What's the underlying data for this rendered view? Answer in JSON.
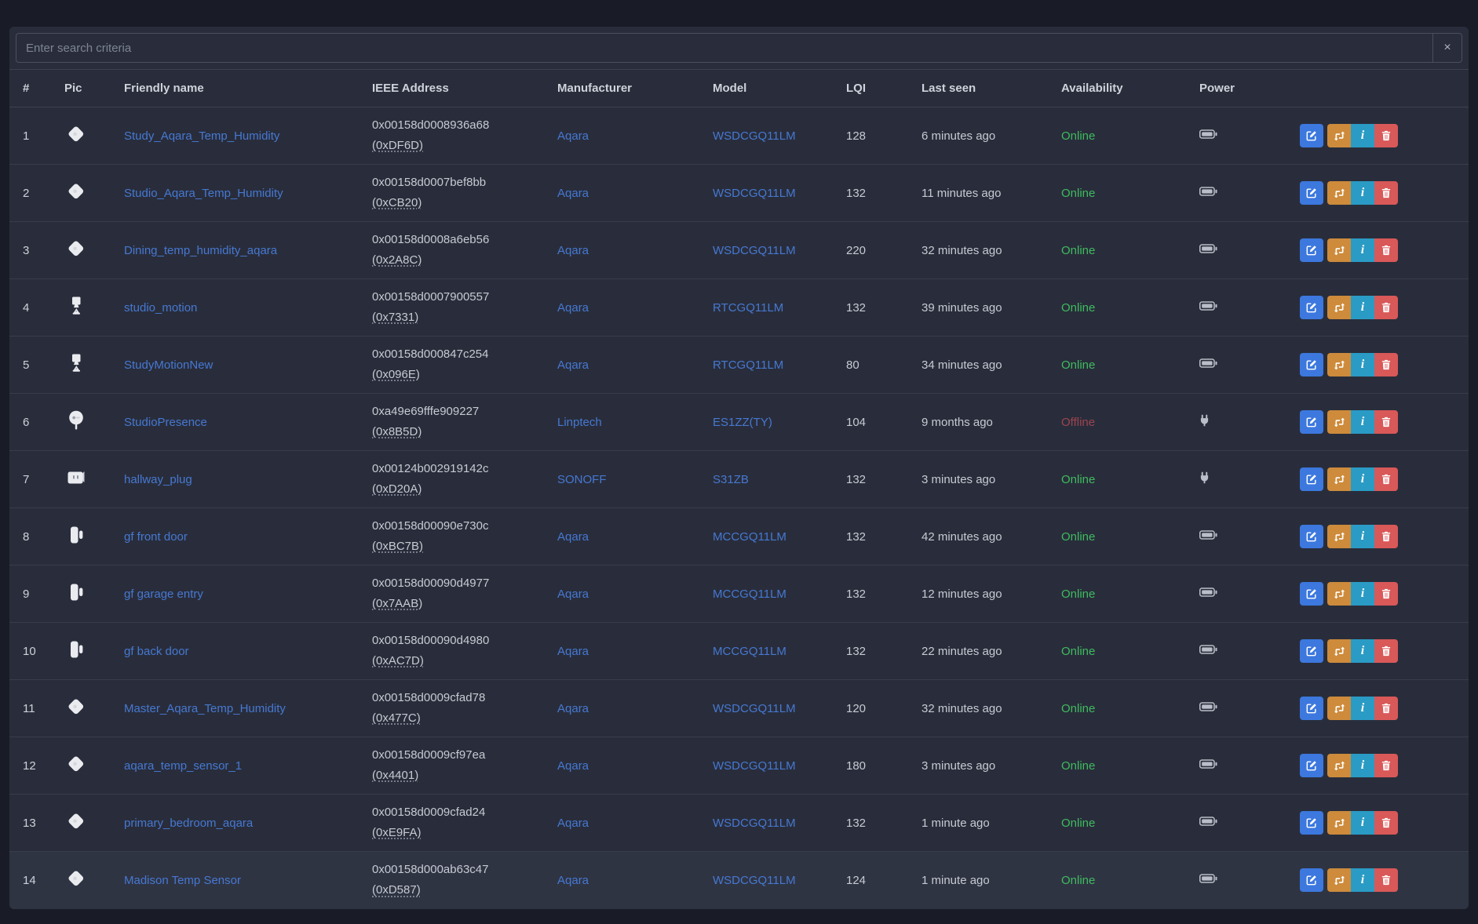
{
  "search": {
    "placeholder": "Enter search criteria",
    "clear_label": "×"
  },
  "colors": {
    "link": "#4678d2",
    "online": "#3fbb5f",
    "offline": "#9c4450",
    "primary": "#3c78de",
    "warning": "#cd8b3b",
    "info": "#2a9bc4",
    "danger": "#d95858",
    "icon_gray": "#b9bec8",
    "device_white": "#e9ebef"
  },
  "row_actions": [
    {
      "name": "rename",
      "icon": "pen-square-icon",
      "style": "primary"
    },
    {
      "name": "reconfigure",
      "icon": "reload-icon",
      "style": "warning"
    },
    {
      "name": "info",
      "icon": "info-icon",
      "style": "info"
    },
    {
      "name": "remove",
      "icon": "trash-icon",
      "style": "danger"
    }
  ],
  "table": {
    "columns": [
      "#",
      "Pic",
      "Friendly name",
      "IEEE Address",
      "Manufacturer",
      "Model",
      "LQI",
      "Last seen",
      "Availability",
      "Power",
      ""
    ],
    "rows": [
      {
        "num": "1",
        "pic": "temp-humidity-sensor",
        "friendly_name": "Study_Aqara_Temp_Humidity",
        "ieee_address": "0x00158d0008936a68",
        "network_address": "(0xDF6D)",
        "manufacturer": "Aqara",
        "model": "WSDCGQ11LM",
        "lqi": "128",
        "last_seen": "6 minutes ago",
        "availability": "Online",
        "power": "battery"
      },
      {
        "num": "2",
        "pic": "temp-humidity-sensor",
        "friendly_name": "Studio_Aqara_Temp_Humidity",
        "ieee_address": "0x00158d0007bef8bb",
        "network_address": "(0xCB20)",
        "manufacturer": "Aqara",
        "model": "WSDCGQ11LM",
        "lqi": "132",
        "last_seen": "11 minutes ago",
        "availability": "Online",
        "power": "battery"
      },
      {
        "num": "3",
        "pic": "temp-humidity-sensor",
        "friendly_name": "Dining_temp_humidity_aqara",
        "ieee_address": "0x00158d0008a6eb56",
        "network_address": "(0x2A8C)",
        "manufacturer": "Aqara",
        "model": "WSDCGQ11LM",
        "lqi": "220",
        "last_seen": "32 minutes ago",
        "availability": "Online",
        "power": "battery"
      },
      {
        "num": "4",
        "pic": "motion-sensor",
        "friendly_name": "studio_motion",
        "ieee_address": "0x00158d0007900557",
        "network_address": "(0x7331)",
        "manufacturer": "Aqara",
        "model": "RTCGQ11LM",
        "lqi": "132",
        "last_seen": "39 minutes ago",
        "availability": "Online",
        "power": "battery"
      },
      {
        "num": "5",
        "pic": "motion-sensor",
        "friendly_name": "StudyMotionNew",
        "ieee_address": "0x00158d000847c254",
        "network_address": "(0x096E)",
        "manufacturer": "Aqara",
        "model": "RTCGQ11LM",
        "lqi": "80",
        "last_seen": "34 minutes ago",
        "availability": "Online",
        "power": "battery"
      },
      {
        "num": "6",
        "pic": "presence-sensor",
        "friendly_name": "StudioPresence",
        "ieee_address": "0xa49e69fffe909227",
        "network_address": "(0x8B5D)",
        "manufacturer": "Linptech",
        "model": "ES1ZZ(TY)",
        "lqi": "104",
        "last_seen": "9 months ago",
        "availability": "Offline",
        "power": "plug"
      },
      {
        "num": "7",
        "pic": "smart-plug",
        "friendly_name": "hallway_plug",
        "ieee_address": "0x00124b002919142c",
        "network_address": "(0xD20A)",
        "manufacturer": "SONOFF",
        "model": "S31ZB",
        "lqi": "132",
        "last_seen": "3 minutes ago",
        "availability": "Online",
        "power": "plug"
      },
      {
        "num": "8",
        "pic": "door-sensor",
        "friendly_name": "gf front door",
        "ieee_address": "0x00158d00090e730c",
        "network_address": "(0xBC7B)",
        "manufacturer": "Aqara",
        "model": "MCCGQ11LM",
        "lqi": "132",
        "last_seen": "42 minutes ago",
        "availability": "Online",
        "power": "battery"
      },
      {
        "num": "9",
        "pic": "door-sensor",
        "friendly_name": "gf garage entry",
        "ieee_address": "0x00158d00090d4977",
        "network_address": "(0x7AAB)",
        "manufacturer": "Aqara",
        "model": "MCCGQ11LM",
        "lqi": "132",
        "last_seen": "12 minutes ago",
        "availability": "Online",
        "power": "battery"
      },
      {
        "num": "10",
        "pic": "door-sensor",
        "friendly_name": "gf back door",
        "ieee_address": "0x00158d00090d4980",
        "network_address": "(0xAC7D)",
        "manufacturer": "Aqara",
        "model": "MCCGQ11LM",
        "lqi": "132",
        "last_seen": "22 minutes ago",
        "availability": "Online",
        "power": "battery"
      },
      {
        "num": "11",
        "pic": "temp-humidity-sensor",
        "friendly_name": "Master_Aqara_Temp_Humidity",
        "ieee_address": "0x00158d0009cfad78",
        "network_address": "(0x477C)",
        "manufacturer": "Aqara",
        "model": "WSDCGQ11LM",
        "lqi": "120",
        "last_seen": "32 minutes ago",
        "availability": "Online",
        "power": "battery"
      },
      {
        "num": "12",
        "pic": "temp-humidity-sensor",
        "friendly_name": "aqara_temp_sensor_1",
        "ieee_address": "0x00158d0009cf97ea",
        "network_address": "(0x4401)",
        "manufacturer": "Aqara",
        "model": "WSDCGQ11LM",
        "lqi": "180",
        "last_seen": "3 minutes ago",
        "availability": "Online",
        "power": "battery"
      },
      {
        "num": "13",
        "pic": "temp-humidity-sensor",
        "friendly_name": "primary_bedroom_aqara",
        "ieee_address": "0x00158d0009cfad24",
        "network_address": "(0xE9FA)",
        "manufacturer": "Aqara",
        "model": "WSDCGQ11LM",
        "lqi": "132",
        "last_seen": "1 minute ago",
        "availability": "Online",
        "power": "battery"
      },
      {
        "num": "14",
        "pic": "temp-humidity-sensor",
        "friendly_name": "Madison Temp Sensor",
        "ieee_address": "0x00158d000ab63c47",
        "network_address": "(0xD587)",
        "manufacturer": "Aqara",
        "model": "WSDCGQ11LM",
        "lqi": "124",
        "last_seen": "1 minute ago",
        "availability": "Online",
        "power": "battery",
        "hovered": true
      }
    ]
  }
}
